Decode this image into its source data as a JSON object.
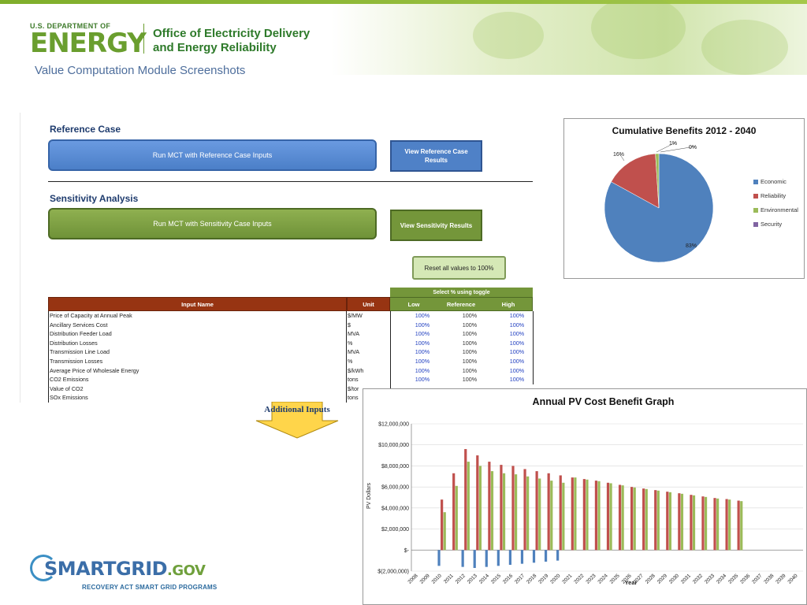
{
  "header": {
    "doe_small": "U.S. DEPARTMENT OF",
    "doe_big": "ENERGY",
    "office_line1": "Office of Electricity Delivery",
    "office_line2": "and Energy Reliability",
    "subtitle": "Value Computation Module Screenshots"
  },
  "module": {
    "reference_title": "Reference Case",
    "run_reference_button": "Run MCT with Reference Case Inputs",
    "view_reference_button": "View Reference Case Results",
    "sensitivity_title": "Sensitivity Analysis",
    "run_sensitivity_button": "Run MCT with Sensitivity Case Inputs",
    "view_sensitivity_button": "View Sensitivity Results",
    "reset_button": "Reset all values to 100%",
    "toggle_header": "Select % using toggle",
    "columns": {
      "name": "Input Name",
      "unit": "Unit",
      "low": "Low",
      "reference": "Reference",
      "high": "High"
    },
    "rows": [
      {
        "name": "Price of Capacity at Annual Peak",
        "unit": "$/MW",
        "low": "100%",
        "ref": "100%",
        "high": "100%"
      },
      {
        "name": "Ancillary Services Cost",
        "unit": "$",
        "low": "100%",
        "ref": "100%",
        "high": "100%"
      },
      {
        "name": "Distribution Feeder Load",
        "unit": "MVA",
        "low": "100%",
        "ref": "100%",
        "high": "100%"
      },
      {
        "name": "Distribution Losses",
        "unit": "%",
        "low": "100%",
        "ref": "100%",
        "high": "100%"
      },
      {
        "name": "Transmission Line Load",
        "unit": "MVA",
        "low": "100%",
        "ref": "100%",
        "high": "100%"
      },
      {
        "name": "Transmission Losses",
        "unit": "%",
        "low": "100%",
        "ref": "100%",
        "high": "100%"
      },
      {
        "name": "Average Price of Wholesale Energy",
        "unit": "$/kWh",
        "low": "100%",
        "ref": "100%",
        "high": "100%"
      },
      {
        "name": "CO2 Emissions",
        "unit": "tons",
        "low": "100%",
        "ref": "100%",
        "high": "100%"
      },
      {
        "name": "Value of CO2",
        "unit": "$/tor",
        "low": "",
        "ref": "",
        "high": ""
      },
      {
        "name": "SOx Emissions",
        "unit": "tons",
        "low": "",
        "ref": "",
        "high": ""
      }
    ],
    "additional_inputs": "Additional Inputs"
  },
  "chart_data": [
    {
      "type": "pie",
      "title": "Cumulative Benefits 2012 - 2040",
      "slices": [
        {
          "name": "Economic",
          "value": 83,
          "label": "83%",
          "color": "#4f81bd"
        },
        {
          "name": "Reliability",
          "value": 16,
          "label": "16%",
          "color": "#c0504d"
        },
        {
          "name": "Environmental",
          "value": 1,
          "label": "1%",
          "color": "#9bbb59"
        },
        {
          "name": "Security",
          "value": 0,
          "label": "0%",
          "color": "#8064a2"
        }
      ],
      "legend_position": "right"
    },
    {
      "type": "bar",
      "title": "Annual PV Cost Benefit Graph",
      "xlabel": "Year",
      "ylabel": "PV Dollars",
      "ylim": [
        -2000000,
        12000000
      ],
      "y_ticks": [
        12000000,
        10000000,
        8000000,
        6000000,
        4000000,
        2000000,
        0,
        -2000000
      ],
      "y_tick_labels": [
        "$12,000,000",
        "$10,000,000",
        "$8,000,000",
        "$6,000,000",
        "$4,000,000",
        "$2,000,000",
        "$-",
        "$(2,000,000)"
      ],
      "grid": true,
      "categories": [
        "2008",
        "2009",
        "2010",
        "2011",
        "2012",
        "2013",
        "2014",
        "2015",
        "2016",
        "2017",
        "2018",
        "2019",
        "2020",
        "2021",
        "2022",
        "2023",
        "2024",
        "2025",
        "2026",
        "2027",
        "2028",
        "2029",
        "2030",
        "2031",
        "2032",
        "2033",
        "2034",
        "2035",
        "2036",
        "2037",
        "2038",
        "2039",
        "2040"
      ],
      "series": [
        {
          "color": "#4f81bd",
          "values": [
            0,
            0,
            -1500000,
            0,
            -1600000,
            -1700000,
            -1600000,
            -1500000,
            -1400000,
            -1300000,
            -1200000,
            -1100000,
            -1000000,
            0,
            0,
            0,
            0,
            0,
            0,
            0,
            0,
            0,
            0,
            0,
            0,
            0,
            0,
            0,
            0,
            0,
            0,
            0,
            0
          ]
        },
        {
          "color": "#c0504d",
          "values": [
            0,
            0,
            4800000,
            7300000,
            9600000,
            9000000,
            8400000,
            8100000,
            8000000,
            7700000,
            7500000,
            7300000,
            7100000,
            6900000,
            6750000,
            6600000,
            6400000,
            6200000,
            6000000,
            5850000,
            5700000,
            5550000,
            5400000,
            5250000,
            5100000,
            4950000,
            4850000,
            4700000,
            0,
            0,
            0,
            0,
            0
          ]
        },
        {
          "color": "#9bbb59",
          "values": [
            0,
            0,
            3600000,
            6100000,
            8400000,
            8000000,
            7500000,
            7300000,
            7200000,
            7000000,
            6800000,
            6600000,
            6400000,
            6900000,
            6700000,
            6550000,
            6350000,
            6150000,
            5950000,
            5800000,
            5650000,
            5500000,
            5350000,
            5200000,
            5050000,
            4900000,
            4800000,
            4650000,
            0,
            0,
            0,
            0,
            0
          ]
        }
      ]
    }
  ],
  "smartgrid": {
    "smart": "SMARTGRID",
    "gov": ".GOV",
    "tagline": "RECOVERY ACT SMART GRID PROGRAMS"
  }
}
